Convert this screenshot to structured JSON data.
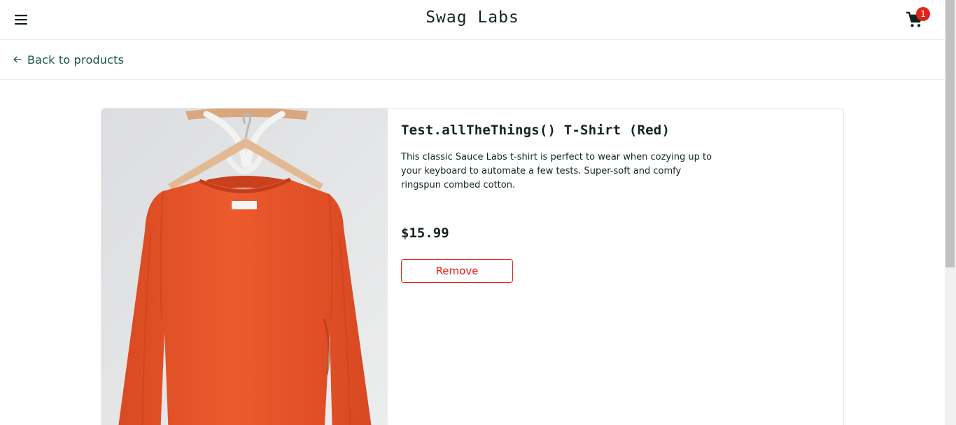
{
  "header": {
    "app_title": "Swag Labs",
    "menu_icon": "hamburger-menu-icon",
    "cart_icon": "shopping-cart-icon",
    "cart_badge_count": "1"
  },
  "subheader": {
    "back_label": "Back to products",
    "back_icon": "arrow-left-icon"
  },
  "product": {
    "name": "Test.allTheThings() T-Shirt (Red)",
    "description": "This classic Sauce Labs t-shirt is perfect to wear when cozying up to your keyboard to automate a few tests. Super-soft and comfy ringspun combed cotton.",
    "price": "$15.99",
    "action_label": "Remove",
    "image": "red-sweatshirt-on-hanger"
  },
  "colors": {
    "accent_green": "#18583a",
    "danger_red": "#e2231a",
    "text_dark": "#132322",
    "shirt_orange": "#e6532a"
  }
}
